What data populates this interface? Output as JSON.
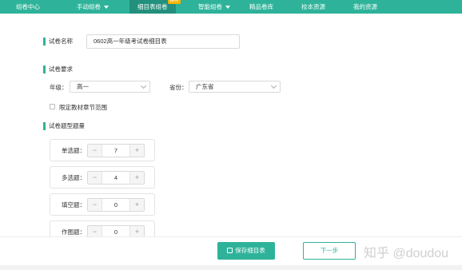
{
  "nav": {
    "items": [
      {
        "label": "组卷中心",
        "dropdown": false
      },
      {
        "label": "手动组卷",
        "dropdown": true
      },
      {
        "label": "细目表组卷",
        "dropdown": false,
        "active": true,
        "badge": "推荐"
      },
      {
        "label": "智能组卷",
        "dropdown": true
      },
      {
        "label": "精品卷库",
        "dropdown": false
      },
      {
        "label": "校本资源",
        "dropdown": false
      },
      {
        "label": "我的资源",
        "dropdown": false
      }
    ]
  },
  "form": {
    "paper_name_label": "试卷名称",
    "paper_name_value": "0602高一年级考试卷细目表",
    "requirements_title": "试卷要求",
    "grade_label": "年级：",
    "grade_value": "高一",
    "province_label": "省份：",
    "province_value": "广东省",
    "limit_chapter_label": "限定教材章节范围",
    "question_count_title": "试卷题型题量",
    "question_types": [
      {
        "label": "单选题：",
        "value": "7"
      },
      {
        "label": "多选题：",
        "value": "4"
      },
      {
        "label": "填空题：",
        "value": "0"
      },
      {
        "label": "作图题：",
        "value": "0"
      }
    ]
  },
  "footer": {
    "save_label": "保存细目表",
    "next_label": "下一步",
    "watermark": "知乎 @doudou"
  }
}
